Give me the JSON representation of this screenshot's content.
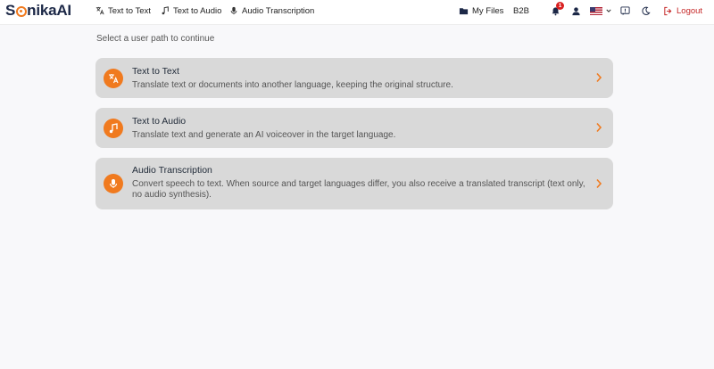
{
  "app": {
    "logo_part1": "S",
    "logo_part2": "nikaAI"
  },
  "nav": [
    {
      "label": "Text to Text",
      "icon": "translate-icon"
    },
    {
      "label": "Text to Audio",
      "icon": "music-note-icon"
    },
    {
      "label": "Audio Transcription",
      "icon": "microphone-icon"
    }
  ],
  "header_right": {
    "my_files": "My Files",
    "b2b": "B2B",
    "notification_count": "1",
    "logout": "Logout"
  },
  "main": {
    "hint": "Select a user path to continue",
    "cards": [
      {
        "title": "Text to Text",
        "description": "Translate text or documents into another language, keeping the original structure.",
        "icon": "translate-icon"
      },
      {
        "title": "Text to Audio",
        "description": "Translate text and generate an AI voiceover in the target language.",
        "icon": "music-note-icon"
      },
      {
        "title": "Audio Transcription",
        "description": "Convert speech to text. When source and target languages differ, you also receive a translated transcript (text only, no audio synthesis).",
        "icon": "microphone-icon"
      }
    ]
  },
  "colors": {
    "accent": "#f07a1f",
    "brand_dark": "#1c2847",
    "card_bg": "#d9d9d9",
    "logout": "#c62828",
    "badge": "#d92020"
  }
}
